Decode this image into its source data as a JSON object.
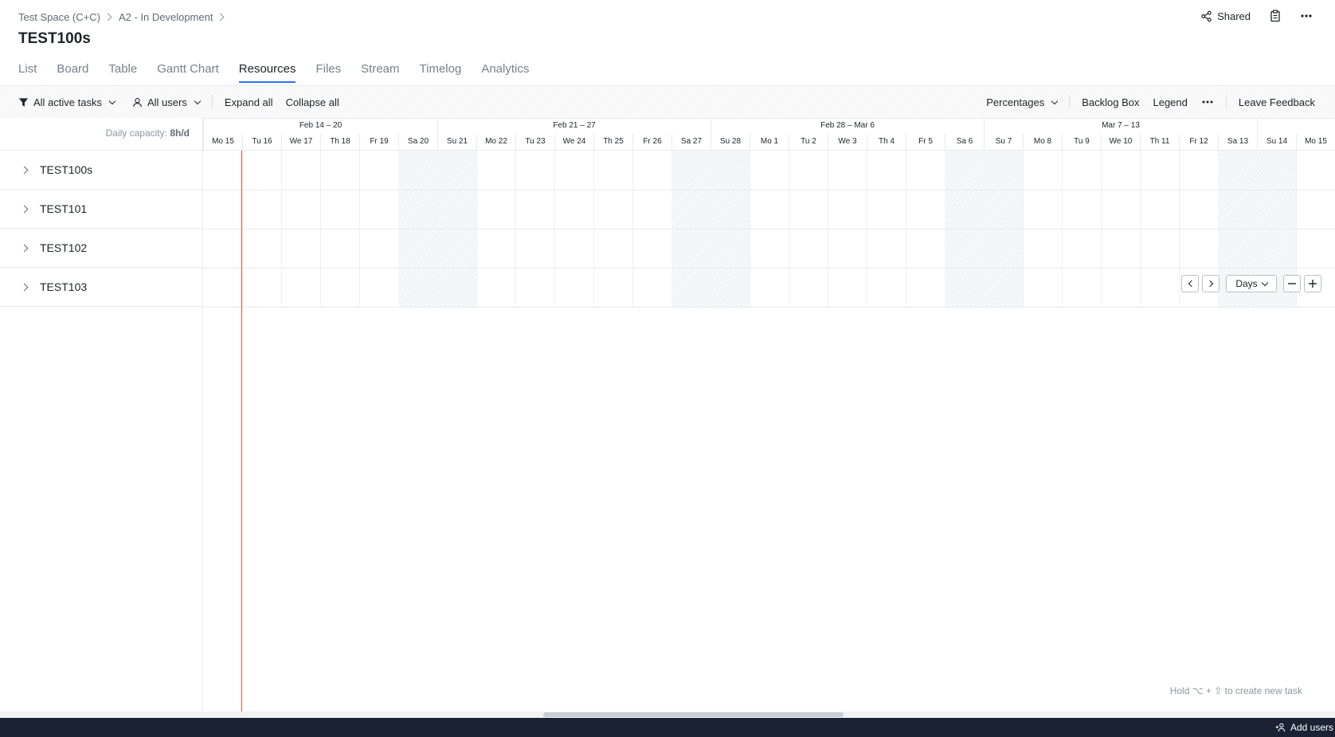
{
  "breadcrumb": {
    "items": [
      "Test Space (C+C)",
      "A2 - In Development"
    ]
  },
  "page": {
    "title": "TEST100s"
  },
  "header": {
    "shared_label": "Shared"
  },
  "tabs": [
    "List",
    "Board",
    "Table",
    "Gantt Chart",
    "Resources",
    "Files",
    "Stream",
    "Timelog",
    "Analytics"
  ],
  "active_tab": "Resources",
  "toolbar": {
    "filter_label": "All active tasks",
    "users_label": "All users",
    "expand_all": "Expand all",
    "collapse_all": "Collapse all",
    "display_mode": "Percentages",
    "backlog_box": "Backlog Box",
    "legend": "Legend",
    "leave_feedback": "Leave Feedback"
  },
  "capacity": {
    "label": "Daily capacity:",
    "value": "8h/d"
  },
  "weeks": [
    "Feb 14 – 20",
    "Feb 21 – 27",
    "Feb 28 – Mar 6",
    "Mar 7 – 13"
  ],
  "days": [
    "Mo 15",
    "Tu 16",
    "We 17",
    "Th 18",
    "Fr 19",
    "Sa 20",
    "Su 21",
    "Mo 22",
    "Tu 23",
    "We 24",
    "Th 25",
    "Fr 26",
    "Sa 27",
    "Su 28",
    "Mo 1",
    "Tu 2",
    "We 3",
    "Th 4",
    "Fr 5",
    "Sa 6",
    "Su 7",
    "Mo 8",
    "Tu 9",
    "We 10",
    "Th 11",
    "Fr 12",
    "Sa 13",
    "Su 14",
    "Mo 15"
  ],
  "rows": [
    "TEST100s",
    "TEST101",
    "TEST102",
    "TEST103"
  ],
  "zoom": {
    "scale_label": "Days"
  },
  "hint": "Hold ⌥ + ⇧ to create new task",
  "footer": {
    "add_users": "Add users"
  },
  "colors": {
    "accent": "#3370ff",
    "today": "#f54a45",
    "footer_bg": "#1b2233"
  }
}
